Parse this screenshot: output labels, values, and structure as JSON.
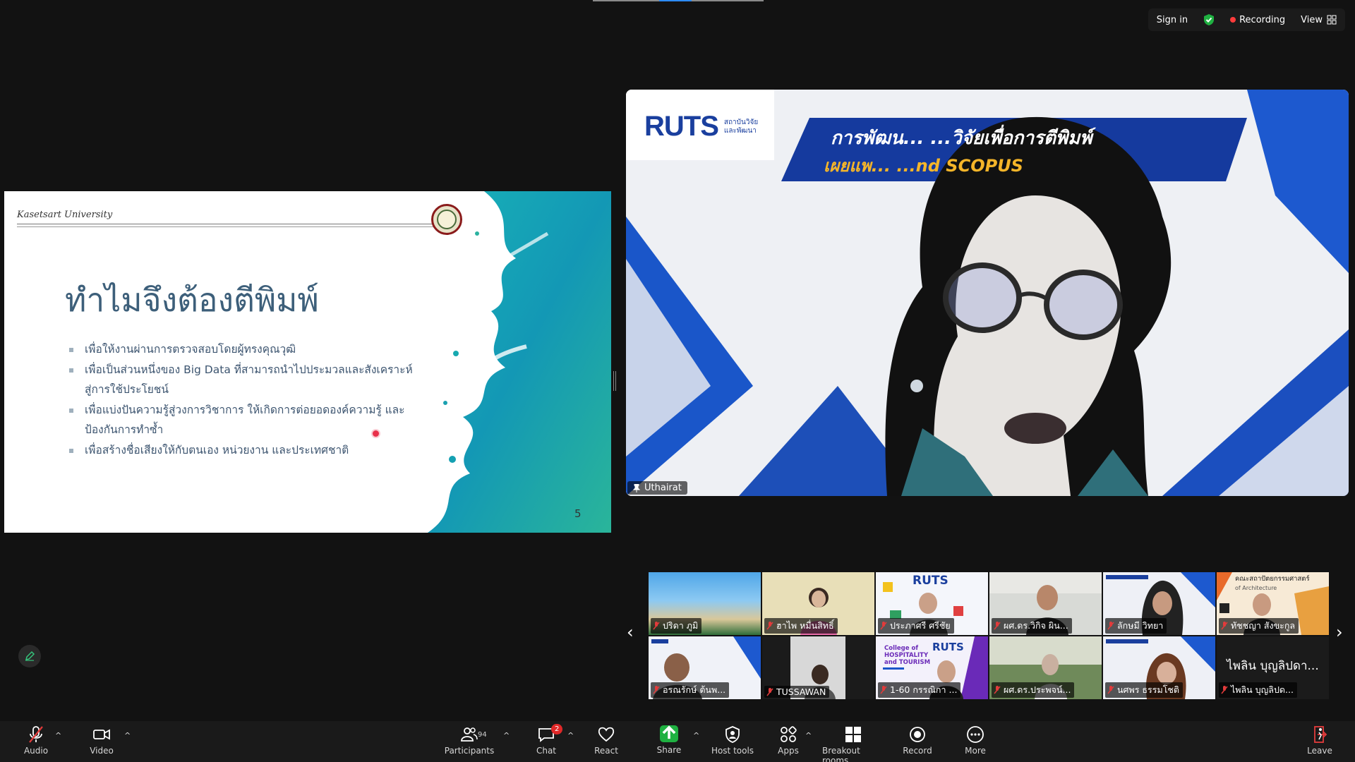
{
  "topbar": {
    "sign_in": "Sign in",
    "recording": "Recording",
    "view": "View",
    "colors": {
      "recording": "#ff3b3b",
      "shield": "#1fb141"
    }
  },
  "slide": {
    "brand": "Kasetsart University",
    "title": "ทำไมจึงต้องตีพิมพ์",
    "bullets": [
      "เพื่อให้งานผ่านการตรวจสอบโดยผู้ทรงคุณวุฒิ",
      "เพื่อเป็นส่วนหนึ่งของ Big Data ที่สามารถนำไปประมวลและสังเคราะห์สู่การใช้ประโยชน์",
      "เพื่อแบ่งปันความรู้สู่วงการวิชาการ ให้เกิดการต่อยอดองค์ความรู้ และป้องกันการทำซ้ำ",
      "เพื่อสร้างชื่อเสียงให้กับตนเอง หน่วยงาน และประเทศชาติ"
    ],
    "page_number": "5"
  },
  "speaker": {
    "name": "Uthairat",
    "banner_logo": "RUTS",
    "banner_logo_sub": "สถาบันวิจัย และพัฒนา",
    "banner_line1": "การพัฒน... ...วิจัยเพื่อการตีพิมพ์",
    "banner_line2": "เผยแพ... ...nd SCOPUS"
  },
  "gallery": {
    "tiles": [
      {
        "name": "ปริดา ภูมิ",
        "bg": "beach"
      },
      {
        "name": "ฮาไพ หมื่นสิทธิ์",
        "bg": "room"
      },
      {
        "name": "ประภาศรี ศรีชัย",
        "bg": "ruts"
      },
      {
        "name": "ผศ.ดร.วิกิจ ผิน...",
        "bg": "office"
      },
      {
        "name": "ลักษมี วิทยา",
        "bg": "banner"
      },
      {
        "name": "ทัชชญา สังขะกูล",
        "bg": "arch"
      },
      {
        "name": "อรณรักษ์ ต้นพ...",
        "bg": "banner2"
      },
      {
        "name": "TUSSAWAN",
        "bg": "dark"
      },
      {
        "name": "1-60 กรรณิกา ...",
        "bg": "hospitality"
      },
      {
        "name": "ผศ.ดร.ประพจน์...",
        "bg": "outdoor"
      },
      {
        "name": "นศพร ธรรมโชติ",
        "bg": "banner3"
      },
      {
        "name": "ไพลิน บุญลิปด...",
        "bg": "black",
        "big": "ไพลิน บุญลิปดา..."
      }
    ],
    "hospitality_text": "College of HOSPITALITY and TOURISM",
    "arch_text": "คณะสถาปัตยกรรมศาสตร์",
    "arch_sub": "of Architecture"
  },
  "toolbar": {
    "audio": "Audio",
    "video": "Video",
    "participants": "Participants",
    "participant_count": "94",
    "chat": "Chat",
    "chat_badge": "2",
    "react": "React",
    "share": "Share",
    "host_tools": "Host tools",
    "apps": "Apps",
    "breakout_rooms": "Breakout rooms",
    "record": "Record",
    "more": "More",
    "leave": "Leave"
  }
}
